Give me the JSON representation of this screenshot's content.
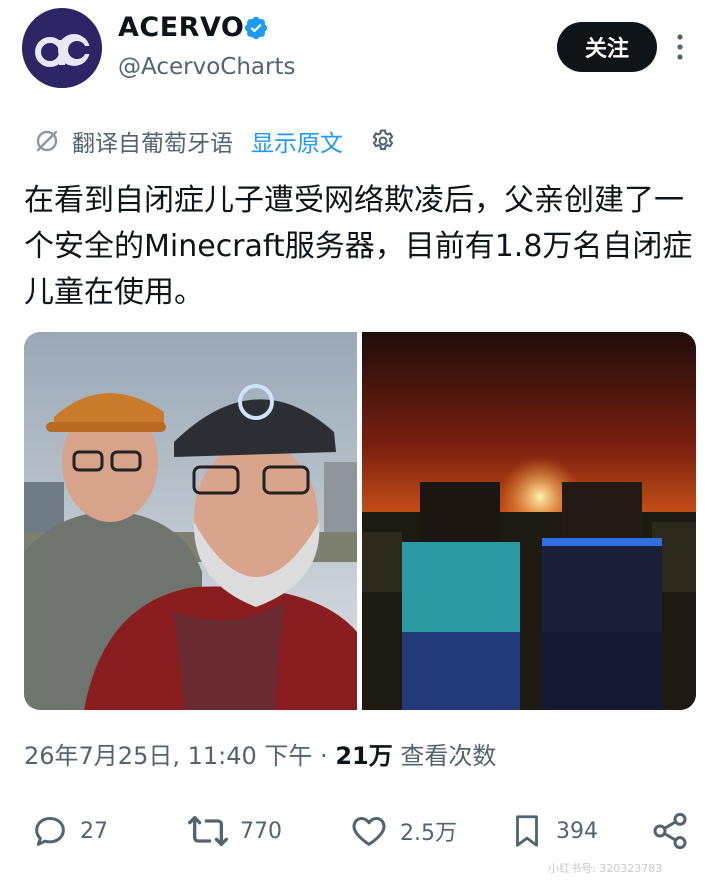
{
  "user": {
    "name": "ACERVO",
    "handle": "@AcervoCharts",
    "avatar_text": "ac"
  },
  "follow_label": "关注",
  "translate": {
    "label": "翻译自葡萄牙语",
    "show_original": "显示原文"
  },
  "tweet": {
    "text": "在看到自闭症儿子遭受网络欺凌后，父亲创建了一个安全的Minecraft服务器，目前有1.8万名自闭症儿童在使用。"
  },
  "meta": {
    "timestamp": "26年7月25日, 11:40 下午",
    "separator": "·",
    "views_count": "21万",
    "views_label": "查看次数"
  },
  "actions": {
    "replies": "27",
    "retweets": "770",
    "likes": "2.5万",
    "bookmarks": "394"
  },
  "watermark": "小红书号: 320323783",
  "colors": {
    "text": "#0f1419",
    "secondary": "#536471",
    "link": "#1d9bf0",
    "verified": "#1d9bf0",
    "follow_bg": "#0f1419"
  },
  "icons": [
    "verified-badge-icon",
    "more-icon",
    "translate-icon",
    "gear-icon",
    "reply-icon",
    "retweet-icon",
    "like-icon",
    "bookmark-icon",
    "share-icon"
  ]
}
